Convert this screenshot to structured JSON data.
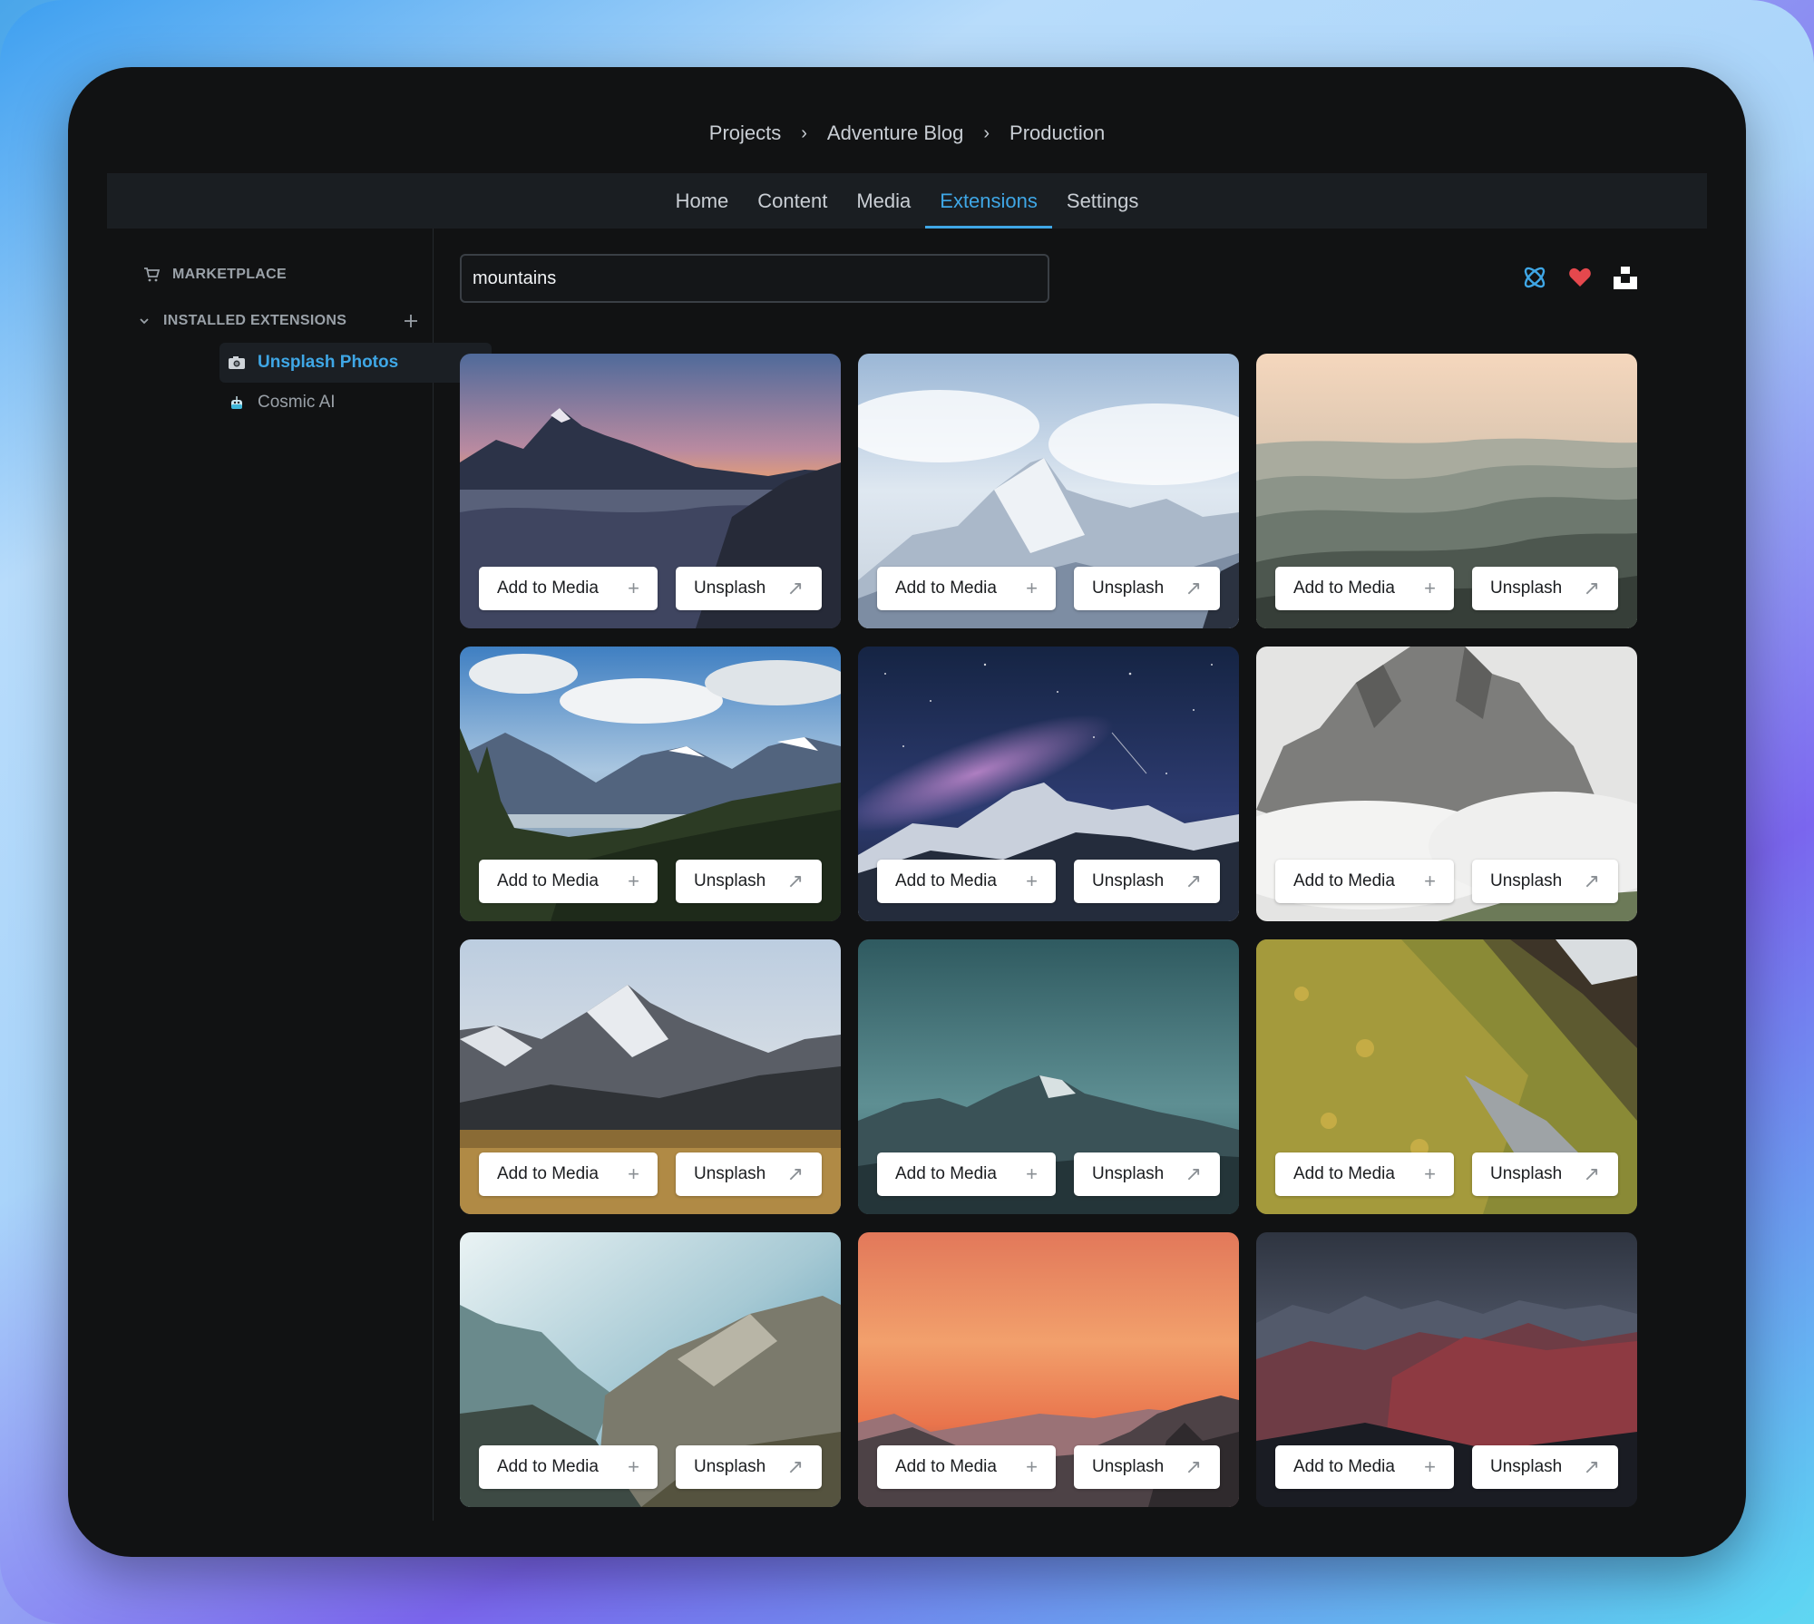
{
  "breadcrumb": [
    "Projects",
    "Adventure Blog",
    "Production"
  ],
  "nav": {
    "tabs": [
      "Home",
      "Content",
      "Media",
      "Extensions",
      "Settings"
    ],
    "active": "Extensions"
  },
  "sidebar": {
    "marketplace_label": "MARKETPLACE",
    "installed_label": "INSTALLED EXTENSIONS",
    "items": [
      {
        "label": "Unsplash Photos",
        "icon": "camera-icon",
        "active": true
      },
      {
        "label": "Cosmic AI",
        "icon": "robot-icon",
        "active": false
      }
    ]
  },
  "search": {
    "value": "mountains"
  },
  "toolbar_icons": [
    "cosmic-icon",
    "heart-icon",
    "unsplash-logo-icon"
  ],
  "colors": {
    "accent": "#3fa7e6",
    "background": "#111213",
    "nav_bg": "#1a1e22",
    "heart": "#e5484d"
  },
  "photos": {
    "add_label": "Add to Media",
    "source_label": "Unsplash",
    "items": [
      {
        "scene": "sunset-peaks-above-clouds"
      },
      {
        "scene": "snowy-peak-blue-sky"
      },
      {
        "scene": "hazy-green-ridges"
      },
      {
        "scene": "valley-with-pine-forest"
      },
      {
        "scene": "milky-way-over-mountains"
      },
      {
        "scene": "rocky-peaks-in-mist"
      },
      {
        "scene": "snow-peak-golden-grass"
      },
      {
        "scene": "teal-dusk-summit"
      },
      {
        "scene": "sunlit-alpine-meadow"
      },
      {
        "scene": "sunbeams-in-valley"
      },
      {
        "scene": "orange-sunset-silhouette"
      },
      {
        "scene": "dark-red-ridges"
      }
    ]
  }
}
